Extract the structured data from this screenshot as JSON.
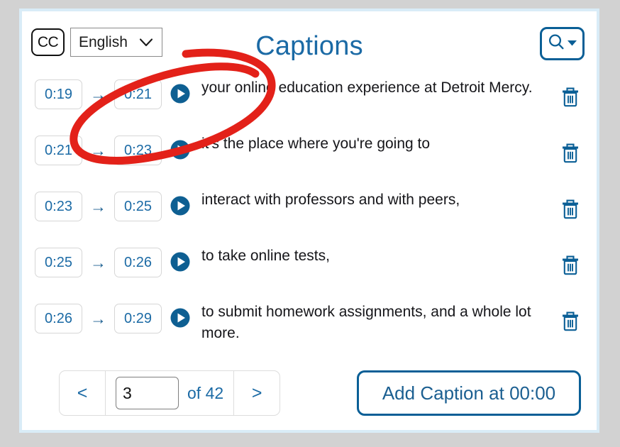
{
  "header": {
    "cc_badge_label": "CC",
    "language_value": "English",
    "language_options": [
      "English"
    ],
    "title": "Captions",
    "search_icon": "search-icon",
    "chevron_icon": "chevron-down-icon",
    "search_caret_icon": "caret-down-icon"
  },
  "captions": [
    {
      "start": "0:19",
      "end": "0:21",
      "arrow": "→",
      "text": "your online education experience at Detroit Mercy.",
      "play_icon": "play-circle-icon",
      "delete_icon": "trash-icon"
    },
    {
      "start": "0:21",
      "end": "0:23",
      "arrow": "→",
      "text": "it's the place where you're going to",
      "play_icon": "play-circle-icon",
      "delete_icon": "trash-icon"
    },
    {
      "start": "0:23",
      "end": "0:25",
      "arrow": "→",
      "text": "interact with professors and with peers,",
      "play_icon": "play-circle-icon",
      "delete_icon": "trash-icon"
    },
    {
      "start": "0:25",
      "end": "0:26",
      "arrow": "→",
      "text": "to take online tests,",
      "play_icon": "play-circle-icon",
      "delete_icon": "trash-icon"
    },
    {
      "start": "0:26",
      "end": "0:29",
      "arrow": "→",
      "text": "to submit homework assignments, and a whole lot more.",
      "play_icon": "play-circle-icon",
      "delete_icon": "trash-icon"
    }
  ],
  "footer": {
    "prev_label": "<",
    "next_label": ">",
    "page_value": "3",
    "of_label": "of 42",
    "add_caption_label": "Add Caption at 00:00"
  },
  "annotation": {
    "type": "hand-drawn-ellipse",
    "color": "#e32119"
  },
  "colors": {
    "accent_blue": "#1b6aa5",
    "deep_blue": "#0a5f96",
    "panel_border": "#d9ecf7",
    "page_background": "#d2d2d2",
    "annotation_red": "#e32119"
  }
}
